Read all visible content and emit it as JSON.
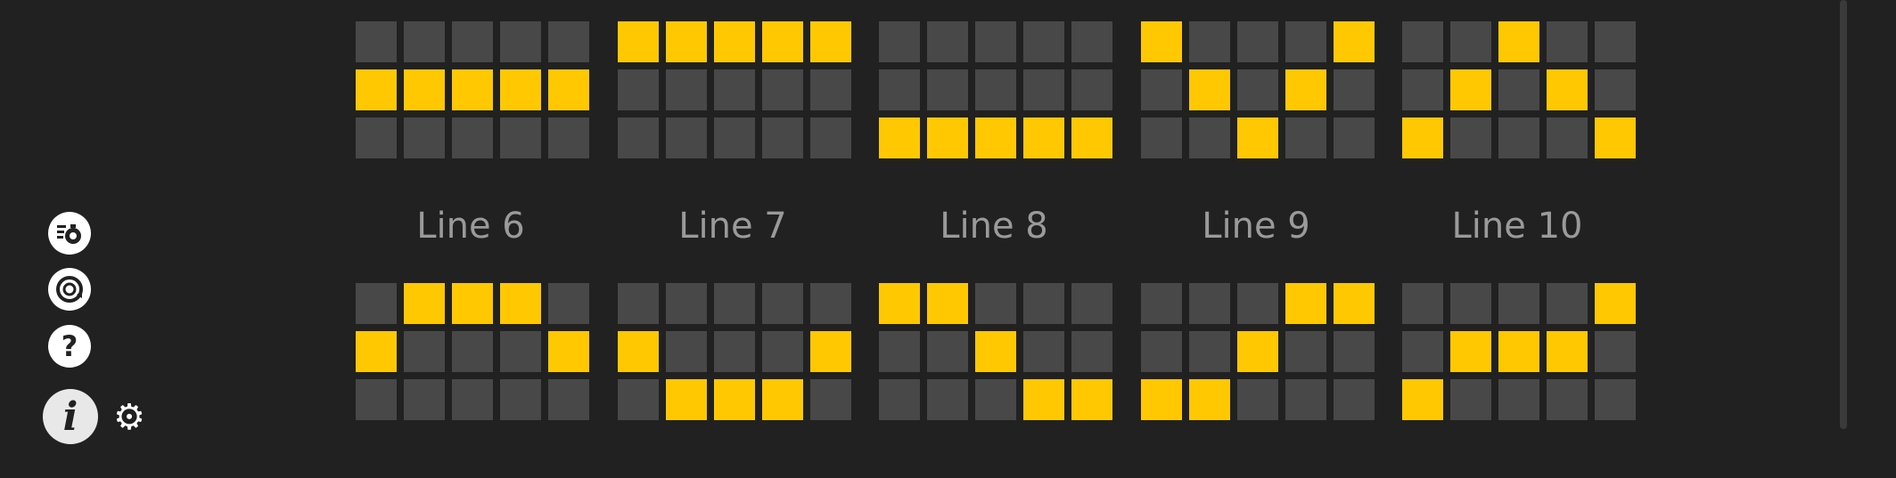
{
  "colors": {
    "background": "#212121",
    "cell_off": "#474847",
    "cell_on": "#ffc800",
    "label": "#9a9a9a"
  },
  "top_patterns": [
    [
      [
        0,
        0,
        0,
        0,
        0
      ],
      [
        1,
        1,
        1,
        1,
        1
      ],
      [
        0,
        0,
        0,
        0,
        0
      ]
    ],
    [
      [
        1,
        1,
        1,
        1,
        1
      ],
      [
        0,
        0,
        0,
        0,
        0
      ],
      [
        0,
        0,
        0,
        0,
        0
      ]
    ],
    [
      [
        0,
        0,
        0,
        0,
        0
      ],
      [
        0,
        0,
        0,
        0,
        0
      ],
      [
        1,
        1,
        1,
        1,
        1
      ]
    ],
    [
      [
        1,
        0,
        0,
        0,
        1
      ],
      [
        0,
        1,
        0,
        1,
        0
      ],
      [
        0,
        0,
        1,
        0,
        0
      ]
    ],
    [
      [
        0,
        0,
        1,
        0,
        0
      ],
      [
        0,
        1,
        0,
        1,
        0
      ],
      [
        1,
        0,
        0,
        0,
        1
      ]
    ]
  ],
  "lines": [
    {
      "label": "Line 6",
      "pattern": [
        [
          0,
          1,
          1,
          1,
          0
        ],
        [
          1,
          0,
          0,
          0,
          1
        ],
        [
          0,
          0,
          0,
          0,
          0
        ]
      ]
    },
    {
      "label": "Line 7",
      "pattern": [
        [
          0,
          0,
          0,
          0,
          0
        ],
        [
          1,
          0,
          0,
          0,
          1
        ],
        [
          0,
          1,
          1,
          1,
          0
        ]
      ]
    },
    {
      "label": "Line 8",
      "pattern": [
        [
          1,
          1,
          0,
          0,
          0
        ],
        [
          0,
          0,
          1,
          0,
          0
        ],
        [
          0,
          0,
          0,
          1,
          1
        ]
      ]
    },
    {
      "label": "Line 9",
      "pattern": [
        [
          0,
          0,
          0,
          1,
          1
        ],
        [
          0,
          0,
          1,
          0,
          0
        ],
        [
          1,
          1,
          0,
          0,
          0
        ]
      ]
    },
    {
      "label": "Line 10",
      "pattern": [
        [
          0,
          0,
          0,
          0,
          1
        ],
        [
          0,
          1,
          1,
          1,
          0
        ],
        [
          1,
          0,
          0,
          0,
          0
        ]
      ]
    }
  ],
  "sidebar": {
    "icons": [
      "paytable-icon",
      "autoplay-icon",
      "help-icon",
      "info-icon",
      "settings-icon"
    ]
  }
}
